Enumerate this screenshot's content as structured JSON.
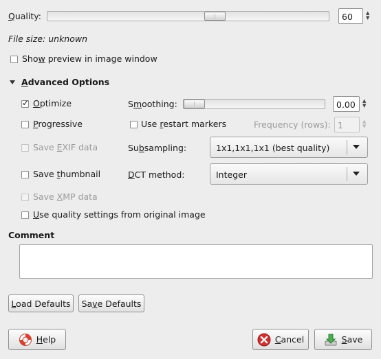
{
  "quality": {
    "label": "Quality:",
    "value": "60",
    "slider_fraction": 0.6
  },
  "file_size": "File size: unknown",
  "show_preview": {
    "label": "Show preview in image window",
    "checked": false
  },
  "advanced": {
    "title": "Advanced Options",
    "optimize": {
      "label": "Optimize",
      "checked": true
    },
    "progressive": {
      "label": "Progressive",
      "checked": false
    },
    "save_exif": {
      "label": "Save EXIF data",
      "checked": false,
      "enabled": false
    },
    "save_thumbnail": {
      "label": "Save thumbnail",
      "checked": false
    },
    "save_xmp": {
      "label": "Save XMP data",
      "checked": false,
      "enabled": false
    },
    "use_quality": {
      "label": "Use quality settings from original image",
      "checked": false
    },
    "smoothing": {
      "label": "Smoothing:",
      "value": "0.00",
      "slider_fraction": 0.0
    },
    "restart_markers": {
      "label": "Use restart markers",
      "checked": false
    },
    "frequency": {
      "label": "Frequency (rows):",
      "value": "1"
    },
    "subsampling": {
      "label": "Subsampling:",
      "value": "1x1,1x1,1x1 (best quality)"
    },
    "dct": {
      "label": "DCT method:",
      "value": "Integer"
    }
  },
  "comment": {
    "label": "Comment",
    "value": ""
  },
  "buttons": {
    "load_defaults": "Load Defaults",
    "save_defaults": "Save Defaults",
    "help": "Help",
    "cancel": "Cancel",
    "save": "Save"
  }
}
